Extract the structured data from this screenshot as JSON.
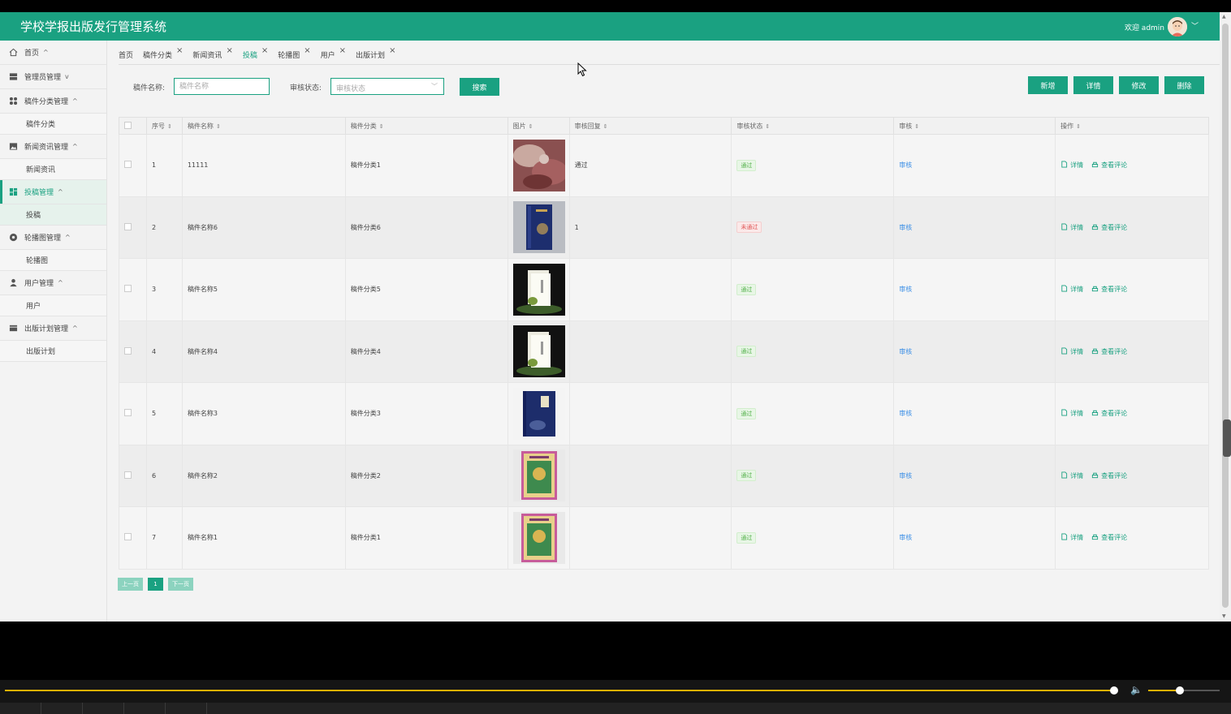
{
  "app": {
    "title": "学校学报出版发行管理系统",
    "welcome": "欢迎 admin"
  },
  "sidebar": {
    "items": [
      {
        "label": "首页",
        "icon": "home-icon"
      },
      {
        "label": "管理员管理",
        "icon": "server-icon"
      },
      {
        "label": "稿件分类管理",
        "icon": "grid-icon",
        "sub": "稿件分类"
      },
      {
        "label": "新闻资讯管理",
        "icon": "picture-icon",
        "sub": "新闻资讯"
      },
      {
        "label": "投稿管理",
        "icon": "dashboard-icon",
        "sub": "投稿"
      },
      {
        "label": "轮播图管理",
        "icon": "circle-icon",
        "sub": "轮播图"
      },
      {
        "label": "用户管理",
        "icon": "user-icon",
        "sub": "用户"
      },
      {
        "label": "出版计划管理",
        "icon": "list-icon",
        "sub": "出版计划"
      }
    ]
  },
  "tabs": [
    "首页",
    "稿件分类",
    "新闻资讯",
    "投稿",
    "轮播图",
    "用户",
    "出版计划"
  ],
  "search": {
    "name_label": "稿件名称:",
    "name_placeholder": "稿件名称",
    "status_label": "审核状态:",
    "status_placeholder": "审核状态",
    "search_button": "搜索"
  },
  "actions": {
    "add": "新增",
    "detail": "详情",
    "edit": "修改",
    "delete": "删除"
  },
  "table": {
    "headers": [
      "序号",
      "稿件名称",
      "稿件分类",
      "图片",
      "审核回复",
      "审核状态",
      "审核",
      "操作"
    ],
    "rows": [
      {
        "no": "1",
        "name": "11111",
        "category": "稿件分类1",
        "reply": "通过",
        "status": "通过",
        "status_kind": "pass",
        "review": "审核",
        "op_detail": "详情",
        "op_comment": "查看评论"
      },
      {
        "no": "2",
        "name": "稿件名称6",
        "category": "稿件分类6",
        "reply": "1",
        "status": "未通过",
        "status_kind": "fail",
        "review": "审核",
        "op_detail": "详情",
        "op_comment": "查看评论"
      },
      {
        "no": "3",
        "name": "稿件名称5",
        "category": "稿件分类5",
        "reply": "",
        "status": "通过",
        "status_kind": "pass",
        "review": "审核",
        "op_detail": "详情",
        "op_comment": "查看评论"
      },
      {
        "no": "4",
        "name": "稿件名称4",
        "category": "稿件分类4",
        "reply": "",
        "status": "通过",
        "status_kind": "pass",
        "review": "审核",
        "op_detail": "详情",
        "op_comment": "查看评论"
      },
      {
        "no": "5",
        "name": "稿件名称3",
        "category": "稿件分类3",
        "reply": "",
        "status": "通过",
        "status_kind": "pass",
        "review": "审核",
        "op_detail": "详情",
        "op_comment": "查看评论"
      },
      {
        "no": "6",
        "name": "稿件名称2",
        "category": "稿件分类2",
        "reply": "",
        "status": "通过",
        "status_kind": "pass",
        "review": "审核",
        "op_detail": "详情",
        "op_comment": "查看评论"
      },
      {
        "no": "7",
        "name": "稿件名称1",
        "category": "稿件分类1",
        "reply": "",
        "status": "通过",
        "status_kind": "pass",
        "review": "审核",
        "op_detail": "详情",
        "op_comment": "查看评论"
      }
    ]
  },
  "pager": {
    "prev": "上一页",
    "current": "1",
    "next": "下一页"
  },
  "colors": {
    "accent": "#1aa181",
    "pass": "#54b14b",
    "fail": "#e05656",
    "link": "#3a8ee6"
  }
}
